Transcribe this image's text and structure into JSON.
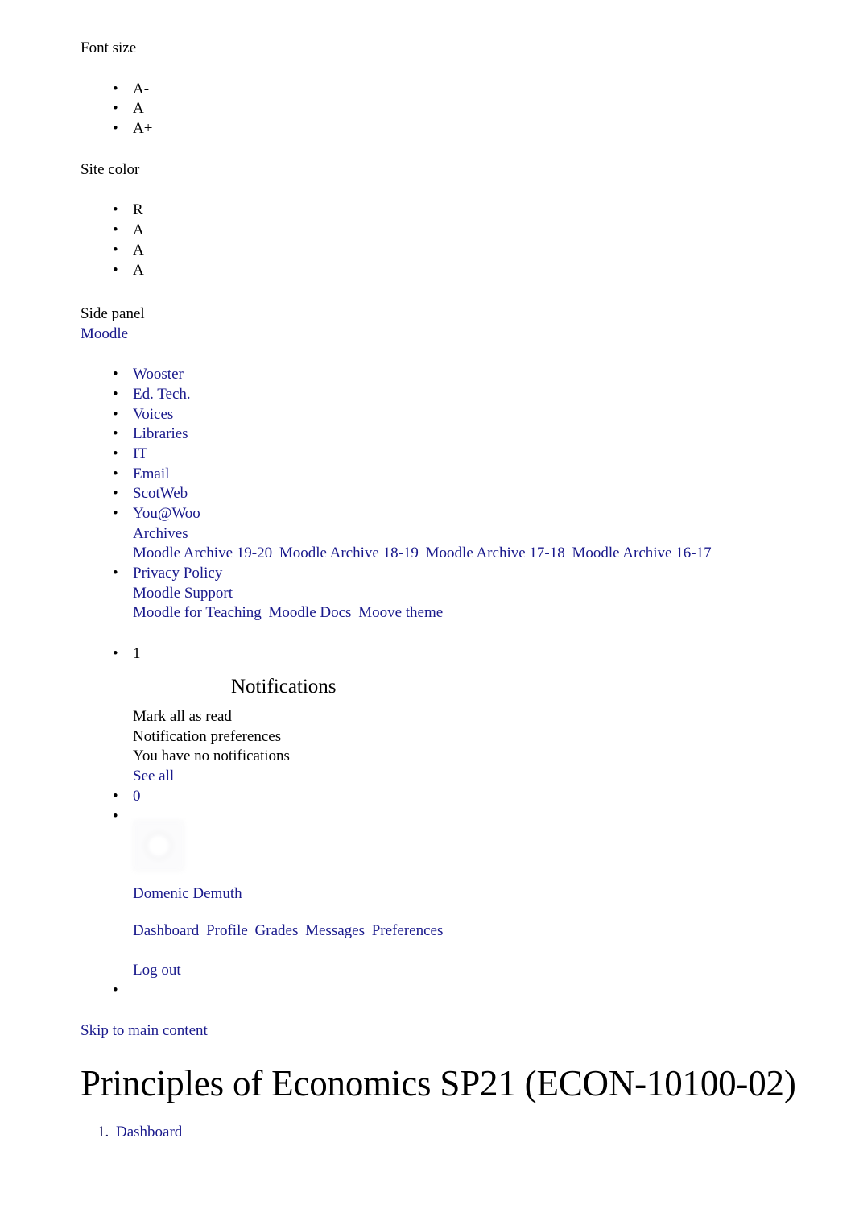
{
  "accessibility": {
    "font_size_label": "Font size",
    "font_size_options": [
      "A-",
      "A",
      "A+"
    ],
    "site_color_label": "Site color",
    "site_color_options": [
      "R",
      "A",
      "A",
      "A"
    ],
    "side_panel_label": "Side panel"
  },
  "brand": {
    "name": "Moodle"
  },
  "primary_nav": {
    "items": [
      {
        "label": "Wooster"
      },
      {
        "label": "Ed. Tech."
      },
      {
        "label": "Voices"
      },
      {
        "label": "Libraries"
      },
      {
        "label": "IT"
      },
      {
        "label": "Email"
      },
      {
        "label": "ScotWeb"
      }
    ],
    "archives_item": {
      "label": "You@Woo",
      "sub_label": "Archives",
      "archive_links": [
        "Moodle Archive 19-20",
        "Moodle Archive 18-19",
        "Moodle Archive 17-18",
        "Moodle Archive 16-17"
      ]
    },
    "support_item": {
      "label": "Privacy Policy",
      "sub_label": "Moodle Support",
      "support_links": [
        "Moodle for Teaching",
        "Moodle Docs",
        "Moove theme"
      ]
    }
  },
  "notifications": {
    "count": "1",
    "title": "Notifications",
    "mark_all_as_read": "Mark all as read",
    "preferences": "Notification preferences",
    "empty_message": "You have no notifications",
    "see_all": "See all"
  },
  "messages": {
    "count": "0"
  },
  "user_menu": {
    "avatar_alt": "",
    "name": "Domenic Demuth",
    "links": [
      "Dashboard",
      "Profile",
      "Grades",
      "Messages",
      "Preferences"
    ],
    "logout": "Log out"
  },
  "main": {
    "skip_link": "Skip to main content",
    "page_title": "Principles of Economics SP21 (ECON-10100-02)",
    "breadcrumb": [
      "Dashboard"
    ]
  },
  "colors": {
    "link": "#1a1a8c",
    "text": "#000000",
    "background": "#ffffff"
  }
}
